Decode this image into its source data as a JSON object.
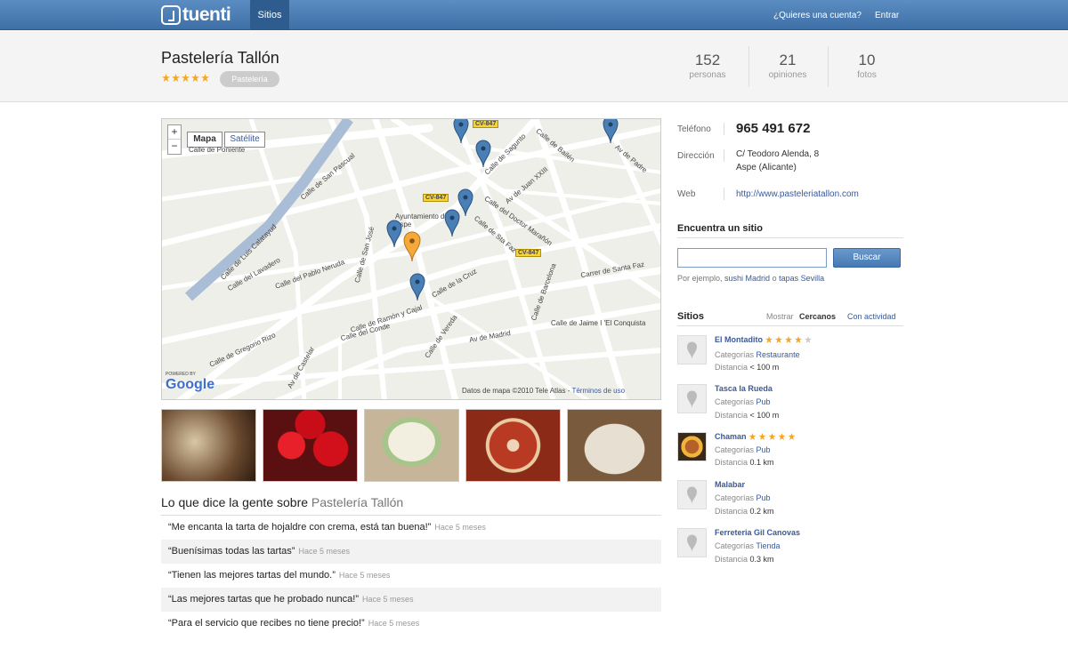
{
  "topbar": {
    "logo_text": "tuenti",
    "nav_tab": "Sitios",
    "account_link": "¿Quieres una cuenta?",
    "login_link": "Entrar"
  },
  "place": {
    "name": "Pastelería Tallón",
    "rating": 5,
    "category": "Pastelería"
  },
  "stats": [
    {
      "number": "152",
      "label": "personas"
    },
    {
      "number": "21",
      "label": "opiniones"
    },
    {
      "number": "10",
      "label": "fotos"
    }
  ],
  "map": {
    "zoom_in": "+",
    "zoom_out": "−",
    "btn_map": "Mapa",
    "btn_satellite": "Satélite",
    "streets": [
      "Calle de Poniente",
      "Calle de San Pascual",
      "Calle de Luis Calatayud",
      "Calle del Lavadero",
      "Calle del Pablo Neruda",
      "Calle de San José",
      "Calle de Gregorio Rizo",
      "Calle del Conde",
      "Calle de Ramón y Cajal",
      "Av de Castelar",
      "Calle de Vereda",
      "Av de Madrid",
      "Calle de Sagunto",
      "Calle de Bailén",
      "Av de Juan XXIII",
      "Calle del Doctor Marañón",
      "Calle de la Cruz",
      "Calle de Sta Faz",
      "Carrer de Santa Faz",
      "Calle de Jaime I 'El Conquista",
      "Calle de Barcelona",
      "Av de Padre"
    ],
    "road_badges": [
      "CV-847",
      "CV-847",
      "CV-847"
    ],
    "poi": "Ayuntamiento de Aspe",
    "powered_by": "POWERED BY",
    "google": "Google",
    "attribution": "Datos de mapa ©2010 Tele Atlas - ",
    "terms": "Términos de uso"
  },
  "comments_section": {
    "title_prefix": "Lo que dice la gente sobre ",
    "title_place": "Pastelería Tallón"
  },
  "comments": [
    {
      "text": "“Me encanta la tarta de hojaldre con crema, está tan buena!”",
      "time": "Hace 5 meses"
    },
    {
      "text": "“Buenísimas todas las tartas”",
      "time": "Hace 5 meses"
    },
    {
      "text": "“Tienen las mejores tartas del mundo.”",
      "time": "Hace 5 meses"
    },
    {
      "text": "“Las mejores tartas que he probado nunca!”",
      "time": "Hace 5 meses"
    },
    {
      "text": "“Para el servicio que recibes no tiene precio!”",
      "time": "Hace 5 meses"
    }
  ],
  "contact": {
    "phone_label": "Teléfono",
    "phone": "965 491 672",
    "address_label": "Dirección",
    "address_line1": "C/ Teodoro Alenda, 8",
    "address_line2": "Aspe (Alicante)",
    "web_label": "Web",
    "web": "http://www.pasteleriatallon.com"
  },
  "search": {
    "title": "Encuentra un sitio",
    "button": "Buscar",
    "hint_prefix": "Por ejemplo, ",
    "hint_ex1": "sushi Madrid",
    "hint_or": " o ",
    "hint_ex2": "tapas Sevilla",
    "value": ""
  },
  "nearby": {
    "title": "Sitios",
    "show_label": "Mostrar",
    "tab_near": "Cercanos",
    "tab_activity": "Con actividad",
    "category_label": "Categorías",
    "distance_label": "Distancia",
    "places": [
      {
        "name": "El Montadito",
        "rating": 4,
        "category": "Restaurante",
        "distance": "< 100 m"
      },
      {
        "name": "Tasca la Rueda",
        "rating": 0,
        "category": "Pub",
        "distance": "< 100 m"
      },
      {
        "name": "Chaman",
        "rating": 5,
        "category": "Pub",
        "distance": "0.1 km"
      },
      {
        "name": "Malabar",
        "rating": 0,
        "category": "Pub",
        "distance": "0.2 km"
      },
      {
        "name": "Ferreteria Gil Canovas",
        "rating": 0,
        "category": "Tienda",
        "distance": "0.3 km"
      }
    ]
  },
  "colors": {
    "brand": "#3e6fa6",
    "link": "#3b5998",
    "star": "#f5a623"
  }
}
